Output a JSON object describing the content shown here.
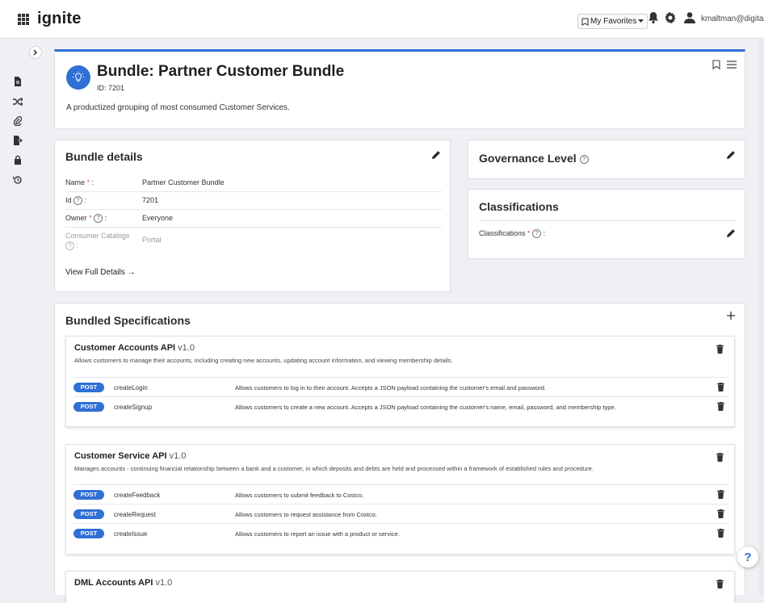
{
  "app": {
    "brand": "ignite"
  },
  "topbar": {
    "favorites_label": "My Favorites",
    "user_email": "kmaltman@digita..."
  },
  "hero": {
    "title": "Bundle: Partner Customer Bundle",
    "id_label": "ID: 7201",
    "description": "A productized grouping of most consumed Customer Services."
  },
  "details": {
    "title": "Bundle details",
    "rows": [
      {
        "key": "Name",
        "value": "Partner Customer Bundle"
      },
      {
        "key": "Id",
        "value": "7201"
      },
      {
        "key": "Owner",
        "value": "Everyone"
      },
      {
        "key": "Consumer Catalogs",
        "value": "Portal"
      }
    ],
    "view_full": "View Full Details →"
  },
  "governance": {
    "title": "Governance Level"
  },
  "classifications": {
    "title": "Classifications",
    "field_label": "Classifications"
  },
  "bundled": {
    "title": "Bundled Specifications",
    "specs": [
      {
        "name": "Customer Accounts API",
        "version": "v1.0",
        "description": "Allows customers to manage their accounts, including creating new accounts, updating account information, and viewing membership details.",
        "ops": [
          {
            "method": "POST",
            "name": "createLogin",
            "desc": "Allows customers to log in to their account. Accepts a JSON payload containing the customer's email and password."
          },
          {
            "method": "POST",
            "name": "createSignup",
            "desc": "Allows customers to create a new account. Accepts a JSON payload containing the customer's name, email, password, and membership type."
          }
        ]
      },
      {
        "name": "Customer Service API",
        "version": "v1.0",
        "description": "Manages accounts - continuing financial relationship between a bank and a customer, in which deposits and debts are held and processed within a framework of established rules and procedure.",
        "ops": [
          {
            "method": "POST",
            "name": "createFeedback",
            "desc": "Allows customers to submit feedback to Costco."
          },
          {
            "method": "POST",
            "name": "createRequest",
            "desc": "Allows customers to request assistance from Costco."
          },
          {
            "method": "POST",
            "name": "createIssue",
            "desc": "Allows customers to report an issue with a product or service."
          }
        ]
      },
      {
        "name": "DML Accounts API",
        "version": "v1.0",
        "description": "",
        "ops": []
      }
    ]
  },
  "help_button": "?",
  "colors": {
    "accent": "#2f6fd6",
    "required": "#d9534f"
  }
}
